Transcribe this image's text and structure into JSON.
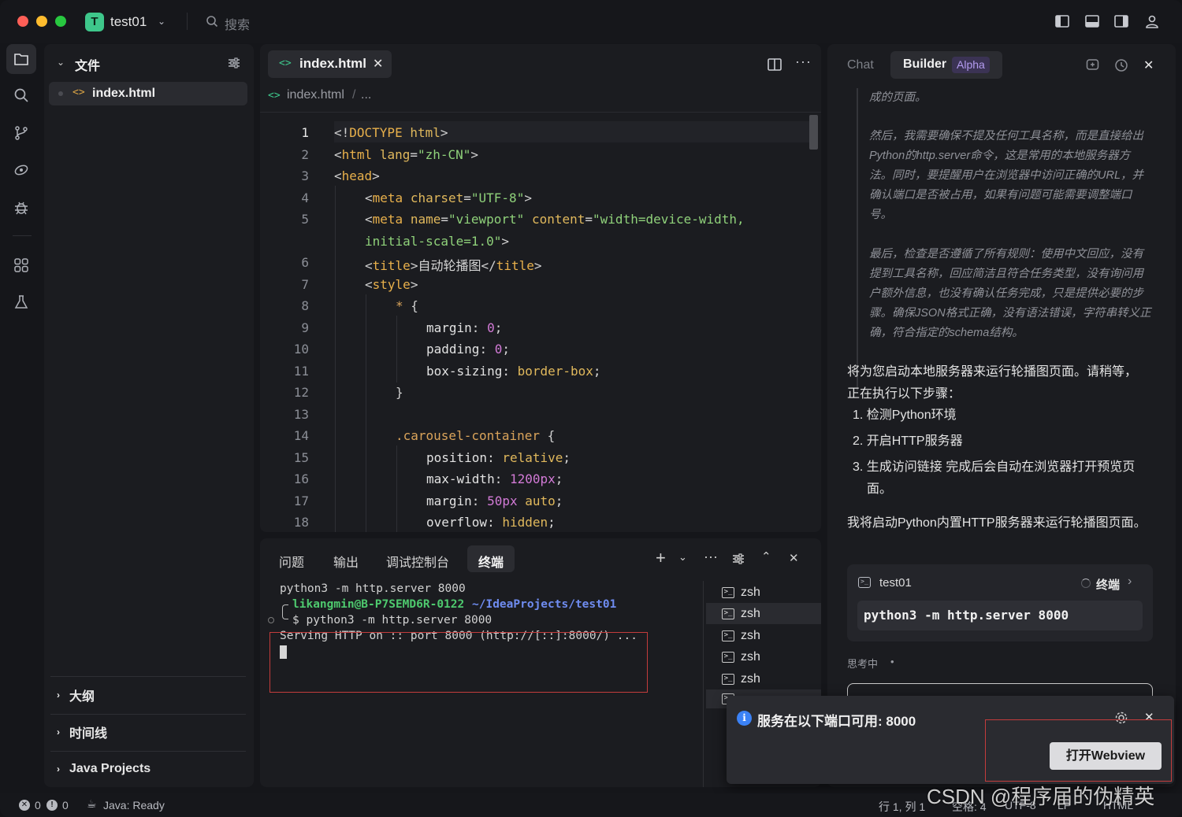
{
  "titlebar": {
    "project_initial": "T",
    "project_name": "test01",
    "search_placeholder": "搜索"
  },
  "explorer": {
    "header": "文件",
    "file": "index.html",
    "sections": [
      "大纲",
      "时间线",
      "Java Projects"
    ]
  },
  "editor": {
    "tab_label": "index.html",
    "breadcrumb_file": "index.html",
    "breadcrumb_sep": "/",
    "breadcrumb_more": "...",
    "line_numbers": [
      "1",
      "2",
      "3",
      "4",
      "5",
      "",
      "6",
      "7",
      "8",
      "9",
      "10",
      "11",
      "12",
      "13",
      "14",
      "15",
      "16",
      "17",
      "18"
    ]
  },
  "bottom_panel": {
    "tabs": [
      "问题",
      "输出",
      "调试控制台",
      "终端"
    ],
    "active_tab": "终端",
    "terminal": {
      "line1": "python3 -m http.server 8000",
      "prompt_user": "likangmin@B-P7SEMD6R-0122",
      "prompt_path": "~/IdeaProjects/test01",
      "prompt_cmd": "$ python3 -m http.server 8000",
      "output": "Serving HTTP on :: port 8000 (http://[::]:8000/) ..."
    },
    "terminal_list": [
      "zsh",
      "zsh",
      "zsh",
      "zsh",
      "zsh"
    ]
  },
  "chat": {
    "tab_chat": "Chat",
    "tab_builder": "Builder",
    "alpha_badge": "Alpha",
    "thinking_1": "成的页面。",
    "thinking_2": "然后，我需要确保不提及任何工具名称，而是直接给出Python的http.server命令，这是常用的本地服务器方法。同时，要提醒用户在浏览器中访问正确的URL，并确认端口是否被占用，如果有问题可能需要调整端口号。",
    "thinking_3": "最后，检查是否遵循了所有规则：使用中文回应，没有提到工具名称，回应简洁且符合任务类型，没有询问用户额外信息，也没有确认任务完成，只是提供必要的步骤。确保JSON格式正确，没有语法错误，字符串转义正确，符合指定的schema结构。",
    "reply_intro": "将为您启动本地服务器来运行轮播图页面。请稍等，正在执行以下步骤：",
    "steps": [
      "1. 检测Python环境",
      "2. 开启HTTP服务器",
      "3. 生成访问链接 完成后会自动在浏览器打开预览页面。"
    ],
    "reply_2": "我将启动Python内置HTTP服务器来运行轮播图页面。",
    "term_card": {
      "name": "test01",
      "status": "终端",
      "command": "python3 -m http.server 8000"
    },
    "thinking_status": "思考中",
    "thinking_dot": "•"
  },
  "notification": {
    "message": "服务在以下端口可用: 8000",
    "button": "打开Webview"
  },
  "statusbar": {
    "errors": "0",
    "warnings": "0",
    "java_status": "Java: Ready",
    "position": "行 1, 列 1",
    "spaces": "空格: 4",
    "encoding": "UTF-8",
    "eol": "LF",
    "language": "HTML"
  },
  "watermark": "CSDN @程序届的伪精英",
  "colors": {
    "accent": "#3ec78b",
    "alpha": "#b49cf0",
    "info": "#3b82f6"
  }
}
